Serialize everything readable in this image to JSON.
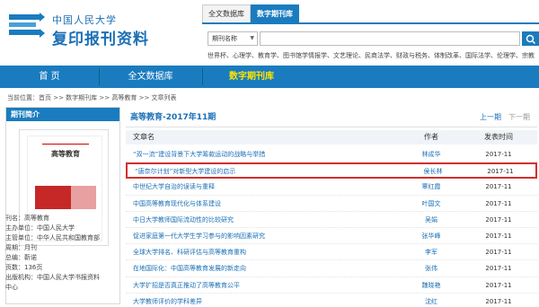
{
  "brand": {
    "line1": "中国人民大学",
    "line2": "复印报刊资料",
    "accent": "#1a7cbf"
  },
  "search": {
    "tabs": [
      "全文数据库",
      "数字期刊库"
    ],
    "active_tab": 1,
    "field_select": "期刊名称",
    "hot": "世界杯、心理学、教育学、图书馆学情报学、文艺理论、民商法学、财政与税务、体制改革、国际法学、伦理学、宗教"
  },
  "nav": {
    "home": "首 页",
    "fulltext": "全文数据库",
    "digital": "数字期刊库"
  },
  "breadcrumb": "当前位置：首页 >> 数字期刊库 >> 高等教育 >> 文章列表",
  "sidebar": {
    "heading": "期刊简介",
    "cover_title": "高等教育",
    "meta": [
      "刊名：高等教育",
      "主办单位：中国人民大学",
      "主管单位：中华人民共和国教育部",
      "周期：月刊",
      "总编：靳诺",
      "页数：136页",
      "出版机构：中国人民大学书报资料",
      "中心"
    ]
  },
  "main": {
    "title": "高等教育-2017年11期",
    "prev": "上一期",
    "next": "下一期",
    "headers": {
      "title": "文章名",
      "author": "作者",
      "date": "发表时间"
    },
    "highlight_index": 1,
    "articles": [
      {
        "title": "“双一流”建设背景下大学筹款运动的战略与举措",
        "author": "林成华",
        "date": "2017-11"
      },
      {
        "title": "“唐奈尔计划”对新型大学建设的启示",
        "author": "侯长林",
        "date": "2017-11"
      },
      {
        "title": "中世纪大学自治的误读与重释",
        "author": "覃红霞",
        "date": "2017-11"
      },
      {
        "title": "中国高等教育现代化与体系建设",
        "author": "叶国文",
        "date": "2017-11"
      },
      {
        "title": "中日大学教师国际流动性的比较研究",
        "author": "吴娟",
        "date": "2017-11"
      },
      {
        "title": "促进家庭第一代大学生学习参与的影响因素研究",
        "author": "张华峰",
        "date": "2017-11"
      },
      {
        "title": "全球大学排名、科研评估与高等教育重构",
        "author": "李军",
        "date": "2017-11"
      },
      {
        "title": "在地国际化：中国高等教育发展的新走向",
        "author": "张伟",
        "date": "2017-11"
      },
      {
        "title": "大学扩招是否真正推动了高等教育公平",
        "author": "魏晓艳",
        "date": "2017-11"
      },
      {
        "title": "大学教师评价的学科差异",
        "author": "沈红",
        "date": "2017-11"
      }
    ]
  }
}
